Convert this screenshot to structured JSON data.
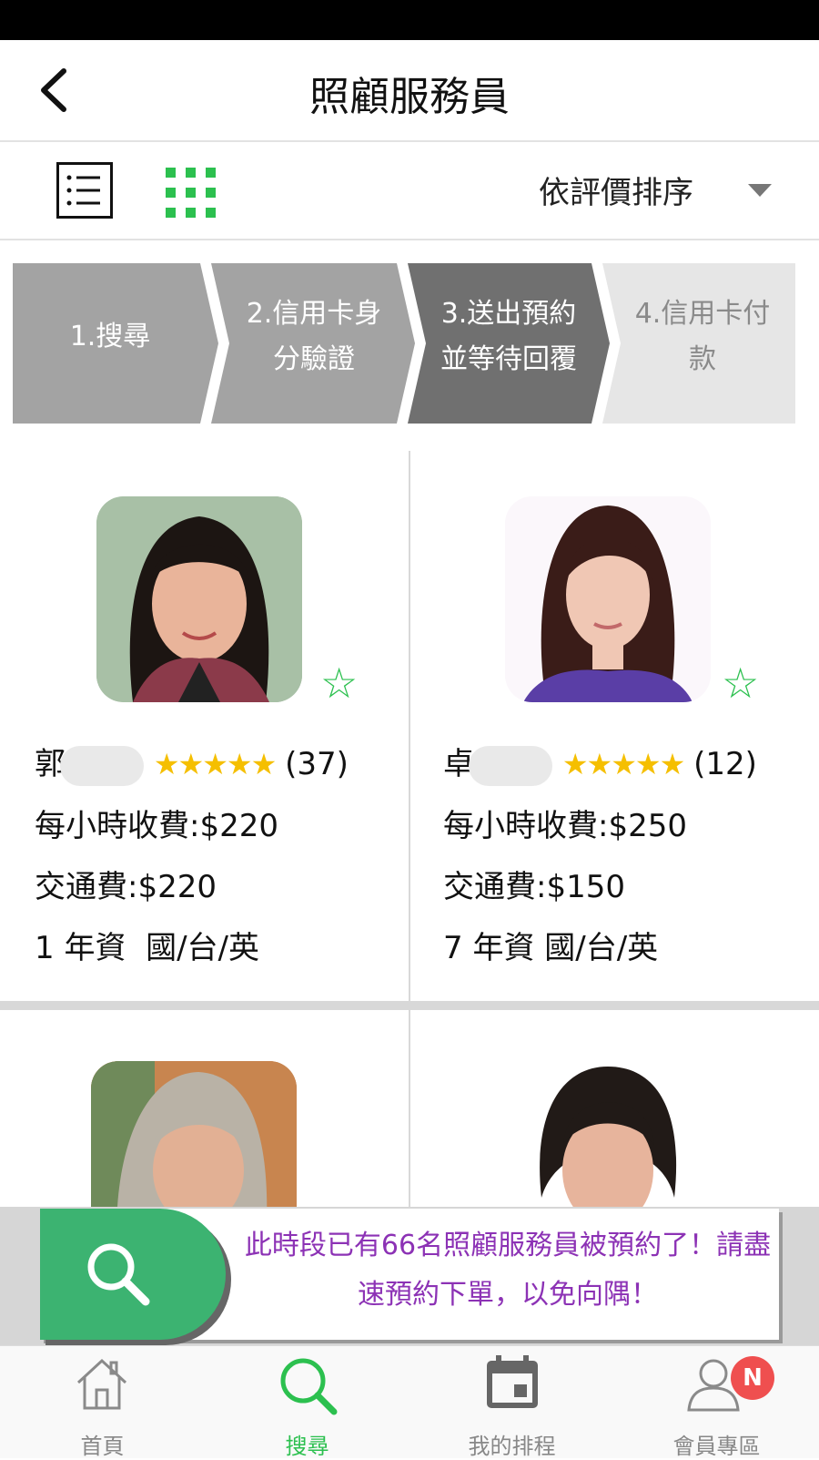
{
  "header": {
    "title": "照顧服務員"
  },
  "toolbar": {
    "sort_label": "依評價排序"
  },
  "steps": [
    {
      "line1": "1.搜尋",
      "line2": ""
    },
    {
      "line1": "2.信用卡身",
      "line2": "分驗證"
    },
    {
      "line1": "3.送出預約",
      "line2": "並等待回覆"
    },
    {
      "line1": "4.信用卡付",
      "line2": "款"
    }
  ],
  "caregivers": [
    {
      "surname": "郭",
      "stars": "★★★★★",
      "reviews": "(37)",
      "hourly": "每小時收費:$220",
      "transport": "交通費:$220",
      "years": "1 年資",
      "languages": "國/台/英",
      "favorite": "☆"
    },
    {
      "surname": "卓",
      "stars": "★★★★★",
      "reviews": "(12)",
      "hourly": "每小時收費:$250",
      "transport": "交通費:$150",
      "years": "7 年資",
      "languages": "國/台/英",
      "favorite": "☆"
    }
  ],
  "banner": {
    "line1": "此時段已有66名照顧服務員被預約了！請盡",
    "line2": "速預約下單，以免向隅！"
  },
  "tabs": [
    {
      "label": "首頁",
      "icon": "home-icon",
      "active": false
    },
    {
      "label": "搜尋",
      "icon": "search-icon",
      "active": true
    },
    {
      "label": "我的排程",
      "icon": "calendar-icon",
      "active": false
    },
    {
      "label": "會員專區",
      "icon": "member-icon",
      "active": false
    }
  ],
  "badge": "N",
  "colors": {
    "accent_green": "#2cc04f",
    "banner_green": "#3cb371",
    "banner_text": "#8c32b5",
    "star_gold": "#f5bf00",
    "badge_red": "#ef4f4f"
  }
}
